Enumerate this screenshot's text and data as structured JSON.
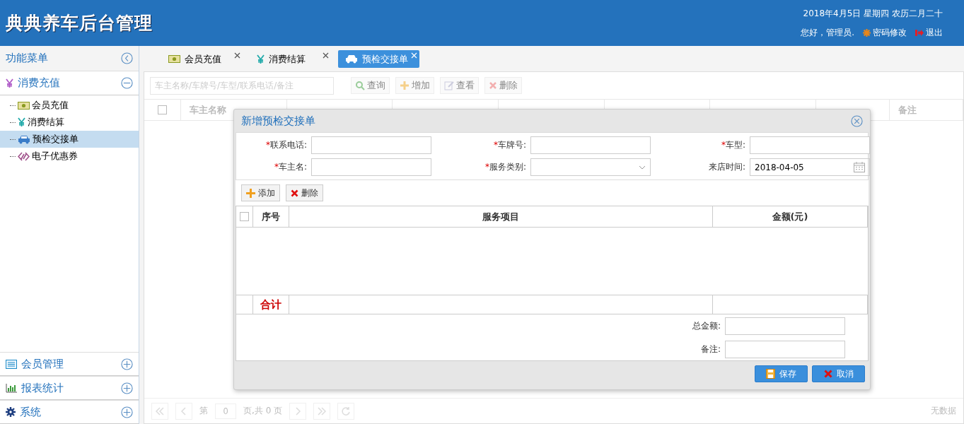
{
  "header": {
    "title": "典典养车后台管理",
    "date": "2018年4月5日 星期四 农历二月二十",
    "greeting": "您好，管理员.",
    "change_password": "密码修改",
    "logout": "退出"
  },
  "sidebar": {
    "title": "功能菜单",
    "groups": [
      {
        "label": "消费充值",
        "expanded": true,
        "items": [
          {
            "label": "会员充值",
            "selected": false
          },
          {
            "label": "消费结算",
            "selected": false
          },
          {
            "label": "预检交接单",
            "selected": true
          },
          {
            "label": "电子优惠券",
            "selected": false
          }
        ]
      },
      {
        "label": "会员管理",
        "expanded": false
      },
      {
        "label": "报表统计",
        "expanded": false
      },
      {
        "label": "系统",
        "expanded": false
      }
    ]
  },
  "tabs": [
    {
      "label": "会员充值",
      "selected": false
    },
    {
      "label": "消费结算",
      "selected": false
    },
    {
      "label": "预检交接单",
      "selected": true
    }
  ],
  "toolbar": {
    "search_placeholder": "车主名称/车牌号/车型/联系电话/备注",
    "buttons": [
      {
        "label": "查询",
        "disabled": true
      },
      {
        "label": "增加",
        "disabled": true
      },
      {
        "label": "查看",
        "disabled": true
      },
      {
        "label": "删除",
        "disabled": true
      }
    ]
  },
  "grid": {
    "select_all_checked": false,
    "first_column": "车主名称",
    "last_column": "备注"
  },
  "pager": {
    "page_prefix": "第",
    "page_value": "0",
    "page_suffix": "页,共 0 页",
    "status": "无数据"
  },
  "dialog": {
    "title": "新增预检交接单",
    "required_mark": "*",
    "fields": [
      {
        "label": "联系电话:",
        "required": true,
        "kind": "text"
      },
      {
        "label": "车牌号:",
        "required": true,
        "kind": "text"
      },
      {
        "label": "车型:",
        "required": true,
        "kind": "text"
      },
      {
        "label": "车主名:",
        "required": true,
        "kind": "text"
      },
      {
        "label": "服务类别:",
        "required": true,
        "kind": "select"
      },
      {
        "label": "来店时间:",
        "required": false,
        "kind": "date",
        "value": "2018-04-05"
      }
    ],
    "actions": [
      "添加",
      "删除"
    ],
    "table": {
      "select_all_checked": false,
      "columns": [
        "序号",
        "服务项目",
        "金额(元)"
      ],
      "total_label": "合计"
    },
    "summary": [
      "总金额:",
      "备注:"
    ],
    "buttons": [
      "保存",
      "取消"
    ]
  }
}
